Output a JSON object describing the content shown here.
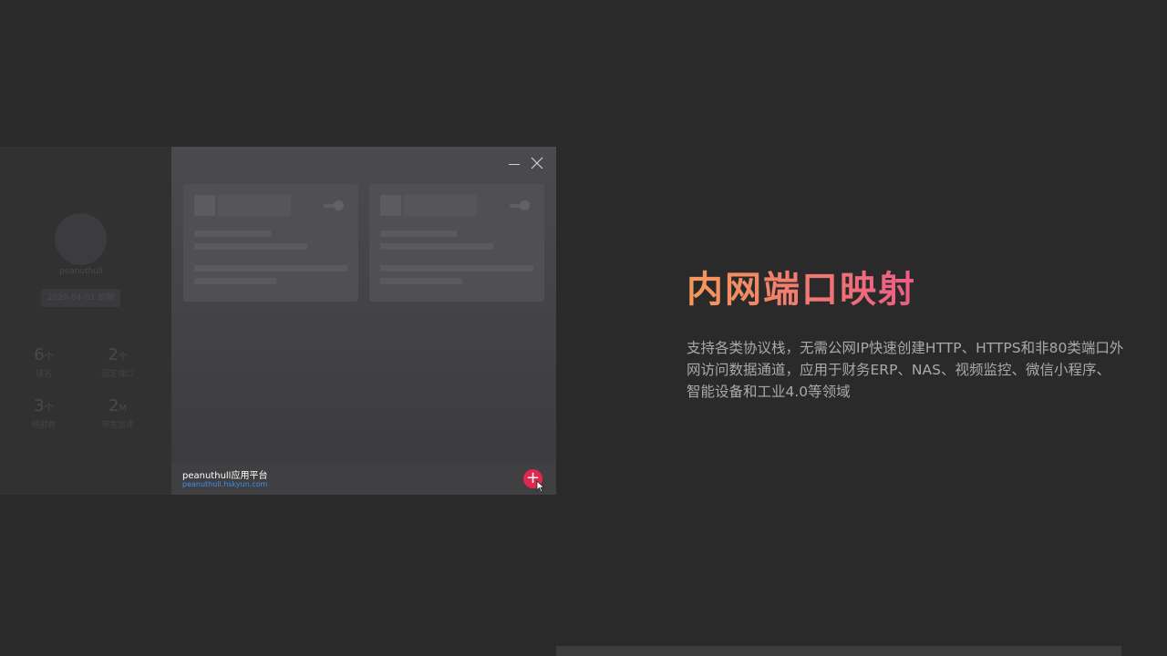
{
  "app": {
    "sidebar": {
      "username": "peanuthull",
      "expiry": "2020-04-01 到期",
      "stats": [
        {
          "value": "6",
          "unit": "个",
          "label": "域名"
        },
        {
          "value": "2",
          "unit": "个",
          "label": "固定端口"
        },
        {
          "value": "3",
          "unit": "个",
          "label": "映射数"
        },
        {
          "value": "2",
          "unit": "M",
          "label": "带宽加速"
        }
      ]
    },
    "window_controls": {
      "minimize": "—",
      "close": "✕"
    },
    "footer": {
      "title": "peanuthull应用平台",
      "url": "peanuthull.hskyun.com",
      "add_label": "+"
    }
  },
  "feature": {
    "title": "内网端口映射",
    "description": "支持各类协议栈，无需公网IP快速创建HTTP、HTTPS和非80类端口外网访问数据通道，应用于财务ERP、NAS、视频监控、微信小程序、智能设备和工业4.0等领域"
  },
  "colors": {
    "background": "#2a2a2a",
    "accent_red": "#e0284f",
    "link_blue": "#3b8fe8",
    "title_gradient_start": "#f59a5a",
    "title_gradient_end": "#ec5c86"
  }
}
